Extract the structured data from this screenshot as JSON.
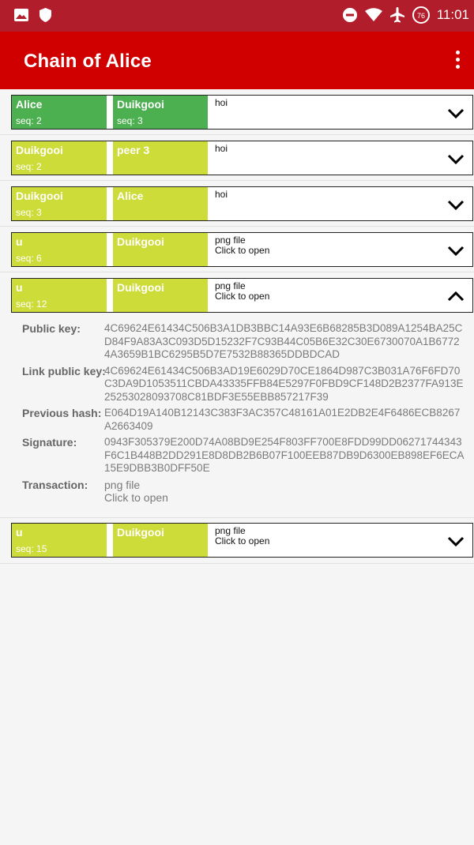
{
  "status_bar": {
    "time": "11:01",
    "battery_level": "76",
    "icons": [
      "image-icon",
      "shield-icon",
      "do-not-disturb-icon",
      "wifi-icon",
      "airplane-icon",
      "battery-icon"
    ]
  },
  "app_bar": {
    "title": "Chain of Alice"
  },
  "colors": {
    "status_bar": "#b21d2b",
    "app_bar": "#d10000",
    "green_block": "#4caf50",
    "lime_block": "#cddc39"
  },
  "blocks": [
    {
      "creator": {
        "name": "Alice",
        "seq": "seq: 2"
      },
      "peer": {
        "name": "Duikgooi",
        "seq": "seq: 3"
      },
      "content": [
        "hoi"
      ],
      "color": "green",
      "expanded": false
    },
    {
      "creator": {
        "name": "Duikgooi",
        "seq": "seq: 2"
      },
      "peer": {
        "name": "peer 3",
        "seq": ""
      },
      "content": [
        "hoi"
      ],
      "color": "lime",
      "expanded": false
    },
    {
      "creator": {
        "name": "Duikgooi",
        "seq": "seq: 3"
      },
      "peer": {
        "name": "Alice",
        "seq": ""
      },
      "content": [
        "hoi"
      ],
      "color": "lime",
      "expanded": false
    },
    {
      "creator": {
        "name": "u",
        "seq": "seq: 6"
      },
      "peer": {
        "name": "Duikgooi",
        "seq": ""
      },
      "content": [
        "png file",
        "Click to open"
      ],
      "color": "lime",
      "expanded": false
    },
    {
      "creator": {
        "name": "u",
        "seq": "seq: 12"
      },
      "peer": {
        "name": "Duikgooi",
        "seq": ""
      },
      "content": [
        "png file",
        "Click to open"
      ],
      "color": "lime",
      "expanded": true
    },
    {
      "creator": {
        "name": "u",
        "seq": "seq: 15"
      },
      "peer": {
        "name": "Duikgooi",
        "seq": ""
      },
      "content": [
        "png file",
        "Click to open"
      ],
      "color": "lime",
      "expanded": false
    }
  ],
  "details": {
    "public_key_label": "Public key:",
    "public_key": "4C69624E61434C506B3A1DB3BBC14A93E6B68285B3D089A1254BA25CD84F9A83A3C093D5D15232F7C93B44C05B6E32C30E6730070A1B67724A3659B1BC6295B5D7E7532B88365DDBDCAD",
    "link_public_key_label": "Link public key:",
    "link_public_key": "4C69624E61434C506B3AD19E6029D70CE1864D987C3B031A76F6FD70C3DA9D1053511CBDA43335FFB84E5297F0FBD9CF148D2B2377FA913E25253028093708C81BDF3E55EBB857217F39",
    "previous_hash_label": "Previous hash:",
    "previous_hash": "E064D19A140B12143C383F3AC357C48161A01E2DB2E4F6486ECB8267A2663409",
    "signature_label": "Signature:",
    "signature": "0943F305379E200D74A08BD9E254F803FF700E8FDD99DD06271744343F6C1B448B2DD291E8D8DB2B6B07F100EEB87DB9D6300EB898EF6ECA15E9DBB3B0DFF50E",
    "transaction_label": "Transaction:",
    "transaction_line1": "png file",
    "transaction_line2": "Click to open"
  }
}
